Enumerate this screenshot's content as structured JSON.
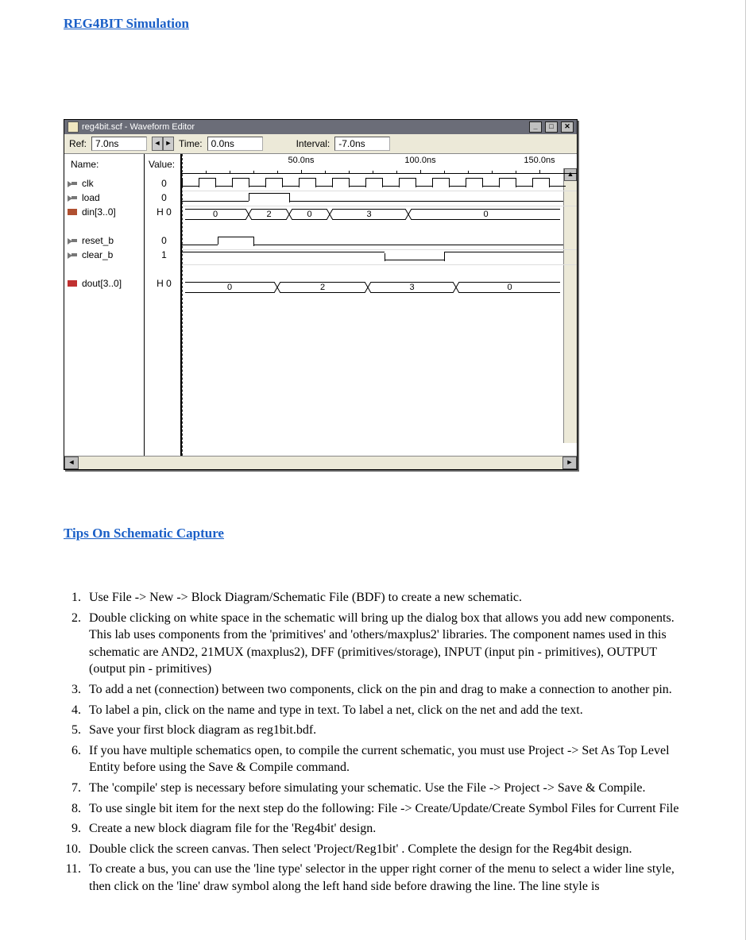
{
  "heading1": "REG4BIT Simulation",
  "heading2": "Tips On Schematic Capture",
  "editor": {
    "title": "reg4bit.scf - Waveform Editor",
    "ref_label": "Ref:",
    "ref_value": "7.0ns",
    "time_label": "Time:",
    "time_value": "0.0ns",
    "interval_label": "Interval:",
    "interval_value": "-7.0ns",
    "name_header": "Name:",
    "value_header": "Value:",
    "ticks": [
      "50.0ns",
      "100.0ns",
      "150.0ns"
    ],
    "signals": [
      {
        "name": "clk",
        "value": "0",
        "icon": "in"
      },
      {
        "name": "load",
        "value": "0",
        "icon": "in"
      },
      {
        "name": "din[3..0]",
        "value": "H 0",
        "icon": "bus",
        "bus": [
          "0",
          "2",
          "0",
          "3",
          "0"
        ]
      },
      {
        "gap": true
      },
      {
        "name": "reset_b",
        "value": "0",
        "icon": "in"
      },
      {
        "name": "clear_b",
        "value": "1",
        "icon": "in"
      },
      {
        "gap": true
      },
      {
        "name": "dout[3..0]",
        "value": "H 0",
        "icon": "out",
        "bus": [
          "0",
          "2",
          "3",
          "0"
        ]
      }
    ],
    "winbtn_min": "_",
    "winbtn_max": "□",
    "winbtn_close": "✕",
    "scroll_left": "◄",
    "scroll_right": "►",
    "scroll_up": "▲"
  },
  "tips": [
    "Use File -> New -> Block Diagram/Schematic File (BDF) to create a new schematic.",
    "Double clicking on white space in the schematic will bring up the dialog box that allows you add new components. This lab uses components from the 'primitives' and 'others/maxplus2'  libraries. The component names used in this schematic are AND2, 21MUX (maxplus2), DFF (primitives/storage), INPUT (input pin - primitives), OUTPUT (output pin - primitives)",
    "To add a net (connection) between two components, click on the pin and drag to make a connection to another pin.",
    "To label a pin, click on the name and type in text. To label a net, click on the net and add the text.",
    "Save your first block diagram as reg1bit.bdf.",
    "If you have multiple schematics open, to compile the current schematic, you must use Project -> Set As Top Level Entity before using the Save & Compile command.",
    "The 'compile' step is necessary before simulating your schematic. Use the File -> Project -> Save & Compile.",
    "To use single bit item for the next step do the following: File -> Create/Update/Create Symbol Files for Current File",
    "Create a new block diagram file for the 'Reg4bit' design.",
    "Double click the screen canvas. Then select 'Project/Reg1bit' . Complete the design for the Reg4bit design.",
    "To create a bus, you can use the 'line type' selector in the upper right corner of the menu to select a wider line style, then click on the 'line' draw symbol along the left hand side before drawing the line. The line style is"
  ],
  "chart_data": {
    "type": "table",
    "title": "Waveform signal values over time (reg4bit.scf)",
    "time_axis_ns": [
      0,
      50,
      100,
      150
    ],
    "signals": {
      "clk": {
        "type": "clock",
        "initial": 0
      },
      "load": {
        "type": "digital",
        "initial": 0,
        "pulses_high_ns": [
          [
            28,
            45
          ]
        ]
      },
      "din[3..0]": {
        "type": "bus",
        "segments": [
          {
            "value": "0",
            "until_ns": 28
          },
          {
            "value": "2",
            "until_ns": 45
          },
          {
            "value": "0",
            "until_ns": 62
          },
          {
            "value": "3",
            "until_ns": 95
          },
          {
            "value": "0",
            "until_ns": 160
          }
        ]
      },
      "reset_b": {
        "type": "digital",
        "initial": 0,
        "pulses_high_ns": [
          [
            15,
            30
          ]
        ]
      },
      "clear_b": {
        "type": "digital",
        "initial": 1,
        "pulses_low_ns": [
          [
            85,
            110
          ]
        ]
      },
      "dout[3..0]": {
        "type": "bus",
        "segments": [
          {
            "value": "0",
            "until_ns": 40
          },
          {
            "value": "2",
            "until_ns": 78
          },
          {
            "value": "3",
            "until_ns": 115
          },
          {
            "value": "0",
            "until_ns": 160
          }
        ]
      }
    }
  }
}
